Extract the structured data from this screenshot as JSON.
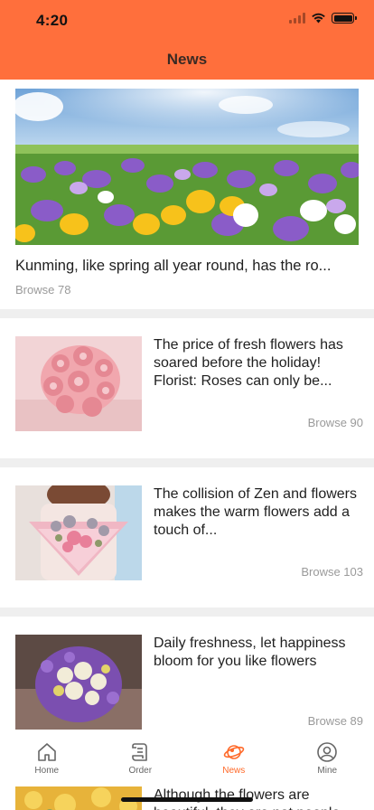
{
  "status": {
    "time": "4:20"
  },
  "header": {
    "title": "News"
  },
  "featured": {
    "title": "Kunming, like spring all year round, has the ro...",
    "browse": "Browse 78"
  },
  "articles": [
    {
      "title": "The price of fresh flowers has soared before the holiday! Florist: Roses can only be...",
      "browse": "Browse 90"
    },
    {
      "title": "The collision of Zen and flowers makes the warm flowers add a touch of...",
      "browse": "Browse 103"
    },
    {
      "title": "Daily freshness, let happiness bloom for you like flowers",
      "browse": "Browse 89"
    },
    {
      "title": "Although the flowers are beautiful, they are not people"
    }
  ],
  "tabbar": {
    "items": [
      {
        "label": "Home",
        "icon": "home-icon"
      },
      {
        "label": "Order",
        "icon": "order-icon"
      },
      {
        "label": "News",
        "icon": "news-icon",
        "active": true
      },
      {
        "label": "Mine",
        "icon": "user-icon"
      }
    ]
  },
  "colors": {
    "header": "#ff6f3c",
    "accent": "#ff6a2a",
    "separator": "#efefef",
    "muted": "#9a9a9a"
  }
}
